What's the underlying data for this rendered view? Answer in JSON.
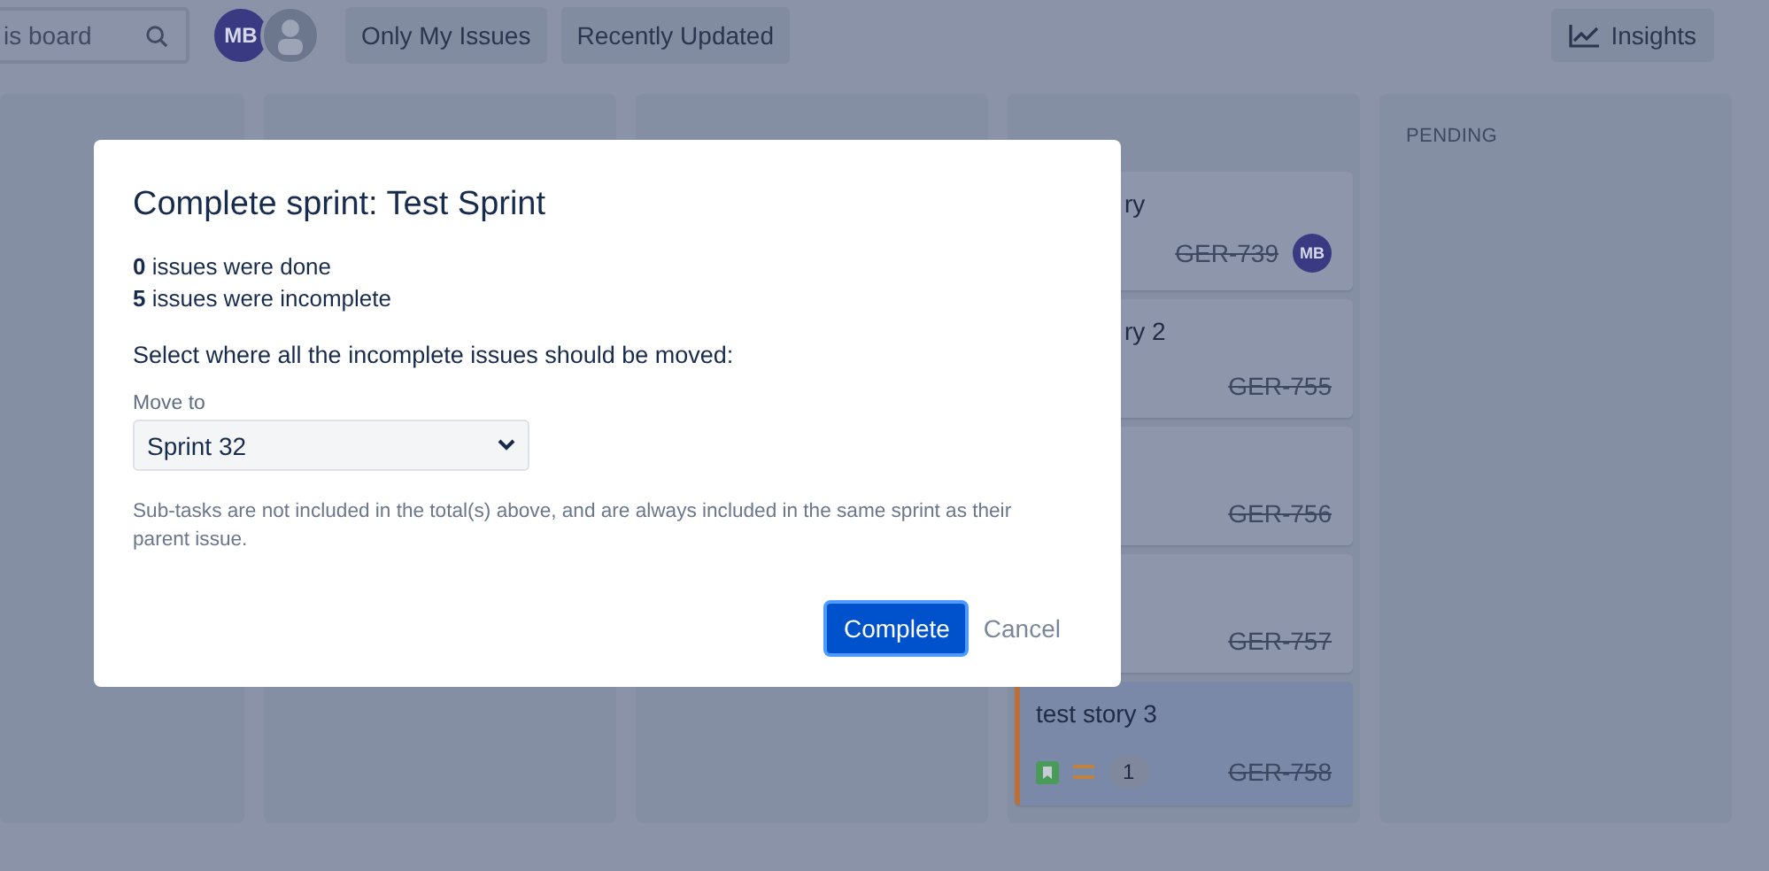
{
  "toolbar": {
    "search": {
      "value": "is board"
    },
    "avatars": [
      {
        "kind": "initials",
        "text": "MB"
      },
      {
        "kind": "silhouette"
      }
    ],
    "filters": [
      "Only My Issues",
      "Recently Updated"
    ],
    "insights": "Insights"
  },
  "columns": [
    {},
    {},
    {},
    {
      "cards": [
        {
          "title": "ry",
          "key": "GER-739",
          "assignee": "MB",
          "flagged": false
        },
        {
          "title": "ry 2",
          "key": "GER-755",
          "flagged": false
        },
        {
          "key": "GER-756",
          "flagged": false
        },
        {
          "key": "GER-757",
          "flagged": false
        },
        {
          "title": "test story 3",
          "key": "GER-758",
          "points": "1",
          "flagged": true
        }
      ]
    },
    {
      "title": "PENDING"
    }
  ],
  "dialog": {
    "title": "Complete sprint: Test Sprint",
    "stats": [
      "**0** issues were done",
      "**5** issues were incomplete"
    ],
    "prompt": "Select where all the incomplete issues should be moved:",
    "move_label": "Move to",
    "move_value": "Sprint 32",
    "note": "Sub-tasks are not included in the total(s) above, and are always included in the same sprint as their parent issue.",
    "primary": "Complete",
    "cancel": "Cancel"
  }
}
